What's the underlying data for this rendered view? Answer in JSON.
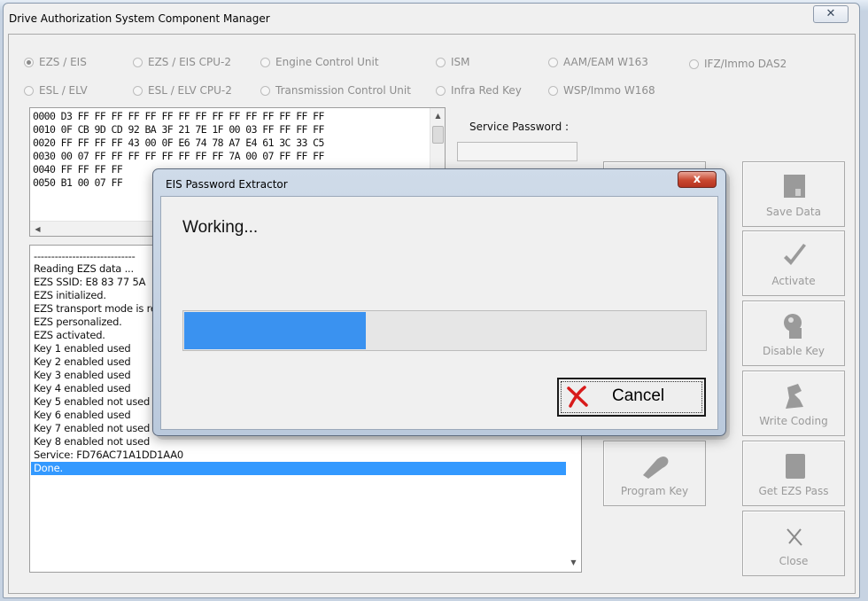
{
  "window": {
    "title": "Drive Authorization System Component Manager",
    "close_glyph": "✕"
  },
  "radios": [
    {
      "label": "EZS / EIS",
      "checked": true
    },
    {
      "label": "EZS / EIS CPU-2",
      "checked": false
    },
    {
      "label": "Engine Control Unit",
      "checked": false
    },
    {
      "label": "ISM",
      "checked": false
    },
    {
      "label": "AAM/EAM W163",
      "checked": false
    },
    {
      "label": "IFZ/Immo DAS2",
      "checked": false
    },
    {
      "label": "ESL / ELV",
      "checked": false
    },
    {
      "label": "ESL / ELV CPU-2",
      "checked": false
    },
    {
      "label": "Transmission Control Unit",
      "checked": false
    },
    {
      "label": "Infra Red Key",
      "checked": false
    },
    {
      "label": "WSP/Immo W168",
      "checked": false
    }
  ],
  "hex_dump": [
    "0000 D3 FF FF FF FF FF FF FF FF FF FF FF FF FF FF FF",
    "0010 0F CB 9D CD 92 BA 3F 21 7E 1F 00 03 FF FF FF FF",
    "0020 FF FF FF FF 43 00 0F E6 74 78 A7 E4 61 3C 33 C5",
    "0030 00 07 FF FF FF FF FF FF FF FF 7A 00 07 FF FF FF",
    "0040 FF FF FF FF",
    "0050 B1 00 07 FF"
  ],
  "service_password": {
    "label": "Service Password :",
    "value": ""
  },
  "log": {
    "lines": [
      "-----------------------------",
      "Reading EZS data ...",
      "EZS SSID: E8 83 77 5A",
      "EZS initialized.",
      "EZS transport mode is re",
      "EZS personalized.",
      "EZS activated.",
      "Key 1 enabled used",
      "Key 2 enabled used",
      "Key 3 enabled used",
      "Key 4 enabled used",
      "Key 5 enabled not used",
      "Key 6 enabled used",
      "Key 7 enabled not used",
      "Key 8 enabled not used",
      "Service: FD76AC71A1DD1AA0"
    ],
    "selected_line": "Done."
  },
  "buttons": {
    "save_data": "Save Data",
    "activate": "Activate",
    "disable_key": "Disable Key",
    "write_coding": "Write Coding",
    "program_key": "Program Key",
    "get_ezs_pass": "Get EZS Pass",
    "close": "Close"
  },
  "dialog": {
    "title": "EIS Password Extractor",
    "close_glyph": "x",
    "status": "Working...",
    "progress": 0.35,
    "cancel_label": "Cancel"
  },
  "colors": {
    "selection": "#3399ff",
    "progress": "#3a92f0",
    "cancel_x": "#d81b1b"
  }
}
